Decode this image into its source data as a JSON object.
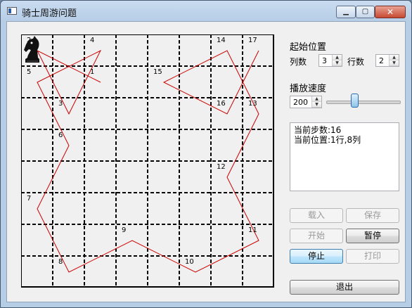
{
  "window": {
    "title": "骑士周游问题"
  },
  "titlebar": {
    "minimize": "▁",
    "maximize": "▢",
    "close": "✕"
  },
  "board": {
    "labels": [
      {
        "text": "2",
        "col": 0,
        "row": 0
      },
      {
        "text": "4",
        "col": 2,
        "row": 0
      },
      {
        "text": "14",
        "col": 6,
        "row": 0
      },
      {
        "text": "17",
        "col": 7,
        "row": 0
      },
      {
        "text": "5",
        "col": 0,
        "row": 1
      },
      {
        "text": "1",
        "col": 2,
        "row": 1
      },
      {
        "text": "15",
        "col": 4,
        "row": 1
      },
      {
        "text": "3",
        "col": 1,
        "row": 2
      },
      {
        "text": "16",
        "col": 6,
        "row": 2
      },
      {
        "text": "13",
        "col": 7,
        "row": 2
      },
      {
        "text": "6",
        "col": 1,
        "row": 3
      },
      {
        "text": "12",
        "col": 6,
        "row": 4
      },
      {
        "text": "7",
        "col": 0,
        "row": 5
      },
      {
        "text": "9",
        "col": 3,
        "row": 6
      },
      {
        "text": "11",
        "col": 7,
        "row": 6
      },
      {
        "text": "8",
        "col": 1,
        "row": 7
      },
      {
        "text": "10",
        "col": 5,
        "row": 7
      }
    ],
    "path_colors": {
      "grid": "#000000",
      "path": "#cc0000"
    }
  },
  "start_position": {
    "heading": "起始位置",
    "col_label": "列数",
    "col_value": "3",
    "row_label": "行数",
    "row_value": "2"
  },
  "speed": {
    "heading": "播放速度",
    "value": "200",
    "slider_level_fraction": 0.37
  },
  "info": {
    "current_step": "当前步数:16",
    "current_position": "当前位置:1行,8列"
  },
  "buttons": {
    "load": "载入",
    "save": "保存",
    "start": "开始",
    "pause": "暂停",
    "stop": "停止",
    "print": "打印",
    "exit": "退出"
  }
}
